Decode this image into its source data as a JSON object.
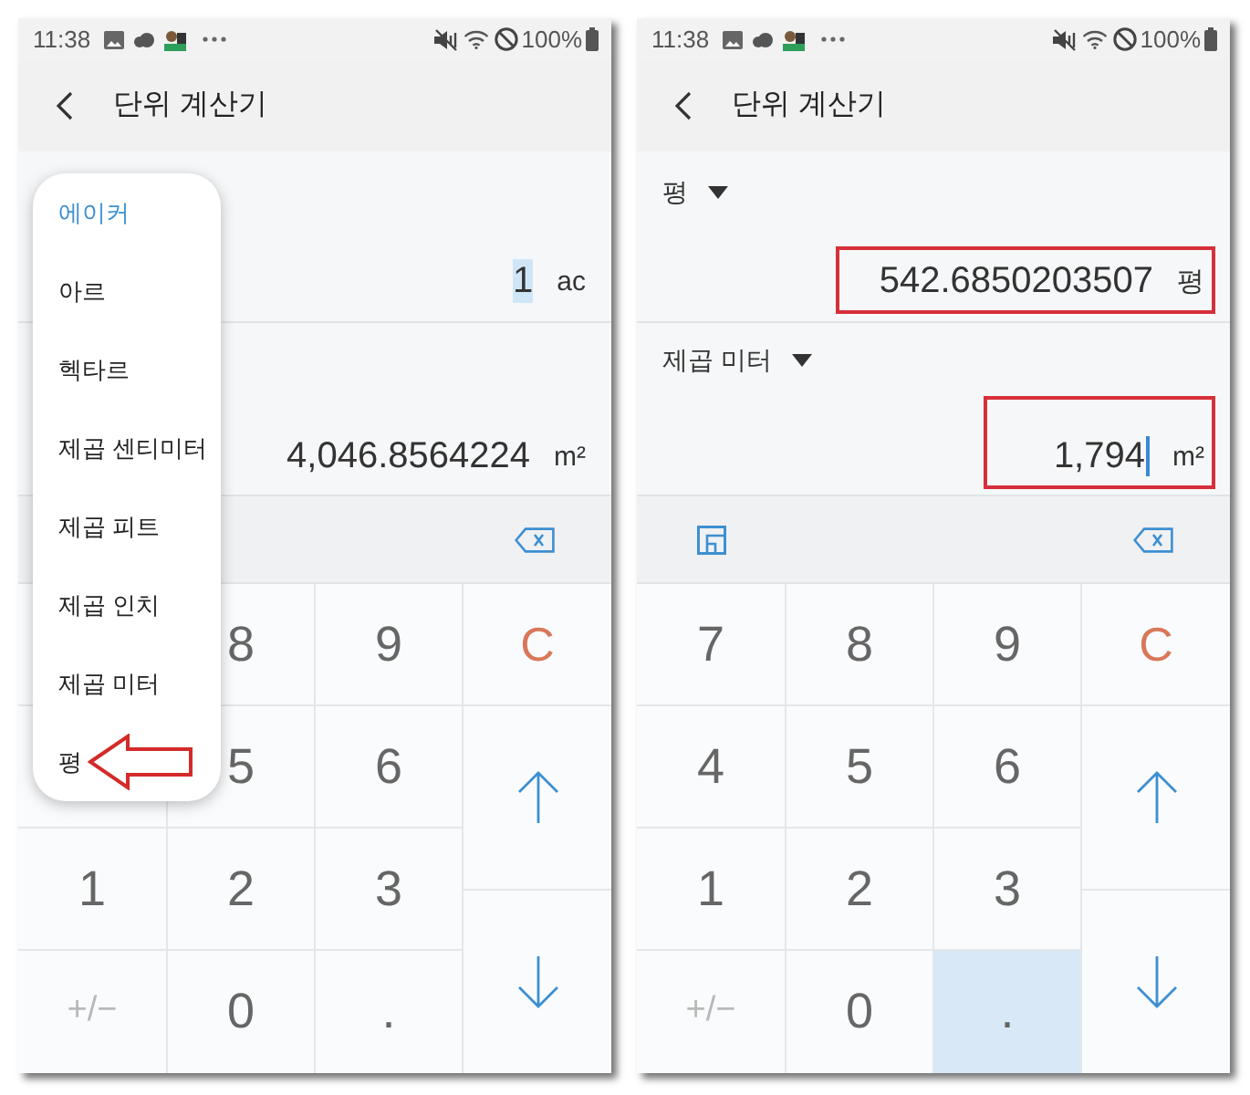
{
  "phones": [
    {
      "status_bar": {
        "time": "11:38",
        "battery": "100%"
      },
      "header": {
        "title": "단위 계산기"
      },
      "converters": [
        {
          "value": "1",
          "unit_symbol": "ac",
          "text_selected": true,
          "cursor": false,
          "highlighted": false
        },
        {
          "value": "4,046.8564224",
          "unit_symbol": "m²",
          "text_selected": false,
          "cursor": false,
          "highlighted": false
        }
      ],
      "toolbar": {
        "buttons": [
          {
            "kind": "backspace"
          }
        ]
      },
      "unit_menu": {
        "items": [
          {
            "label": "에이커",
            "selected": true,
            "pointed": false
          },
          {
            "label": "아르",
            "selected": false,
            "pointed": false
          },
          {
            "label": "헥타르",
            "selected": false,
            "pointed": false
          },
          {
            "label": "제곱 센티미터",
            "selected": false,
            "pointed": false
          },
          {
            "label": "제곱 피트",
            "selected": false,
            "pointed": false
          },
          {
            "label": "제곱 인치",
            "selected": false,
            "pointed": false
          },
          {
            "label": "제곱 미터",
            "selected": false,
            "pointed": false
          },
          {
            "label": "평",
            "selected": false,
            "pointed": true
          }
        ]
      },
      "keypad": {
        "number_keys": [
          {
            "kind": "covered"
          },
          {
            "kind": "digit",
            "label": "8",
            "pressed": false
          },
          {
            "kind": "digit",
            "label": "9",
            "pressed": false
          },
          {
            "kind": "covered"
          },
          {
            "kind": "digit",
            "label": "5",
            "pressed": false
          },
          {
            "kind": "digit",
            "label": "6",
            "pressed": false
          },
          {
            "kind": "digit",
            "label": "1",
            "pressed": false
          },
          {
            "kind": "digit",
            "label": "2",
            "pressed": false
          },
          {
            "kind": "digit",
            "label": "3",
            "pressed": false
          },
          {
            "kind": "sign",
            "label": "+/−",
            "pressed": false
          },
          {
            "kind": "digit",
            "label": "0",
            "pressed": false
          },
          {
            "kind": "point",
            "label": ".",
            "pressed": false
          }
        ],
        "side_keys": [
          {
            "kind": "clear",
            "label": "C",
            "pressed": false
          },
          {
            "kind": "up",
            "pressed": false
          },
          {
            "kind": "down",
            "pressed": false
          }
        ]
      }
    },
    {
      "status_bar": {
        "time": "11:38",
        "battery": "100%"
      },
      "header": {
        "title": "단위 계산기"
      },
      "converters": [
        {
          "unit": "평",
          "value": "542.6850203507",
          "unit_symbol": "평",
          "text_selected": false,
          "cursor": false,
          "highlighted": true
        },
        {
          "unit": "제곱 미터",
          "value": "1,794",
          "unit_symbol": "m²",
          "text_selected": false,
          "cursor": true,
          "highlighted": true
        }
      ],
      "toolbar": {
        "buttons": [
          {
            "kind": "layout"
          },
          {
            "kind": "backspace"
          }
        ]
      },
      "keypad": {
        "number_keys": [
          {
            "kind": "digit",
            "label": "7",
            "pressed": false
          },
          {
            "kind": "digit",
            "label": "8",
            "pressed": false
          },
          {
            "kind": "digit",
            "label": "9",
            "pressed": false
          },
          {
            "kind": "digit",
            "label": "4",
            "pressed": false
          },
          {
            "kind": "digit",
            "label": "5",
            "pressed": false
          },
          {
            "kind": "digit",
            "label": "6",
            "pressed": false
          },
          {
            "kind": "digit",
            "label": "1",
            "pressed": false
          },
          {
            "kind": "digit",
            "label": "2",
            "pressed": false
          },
          {
            "kind": "digit",
            "label": "3",
            "pressed": false
          },
          {
            "kind": "sign",
            "label": "+/−",
            "pressed": false
          },
          {
            "kind": "digit",
            "label": "0",
            "pressed": false
          },
          {
            "kind": "point",
            "label": ".",
            "pressed": true
          }
        ],
        "side_keys": [
          {
            "kind": "clear",
            "label": "C",
            "pressed": false
          },
          {
            "kind": "up",
            "pressed": false
          },
          {
            "kind": "down",
            "pressed": false
          }
        ]
      }
    }
  ]
}
